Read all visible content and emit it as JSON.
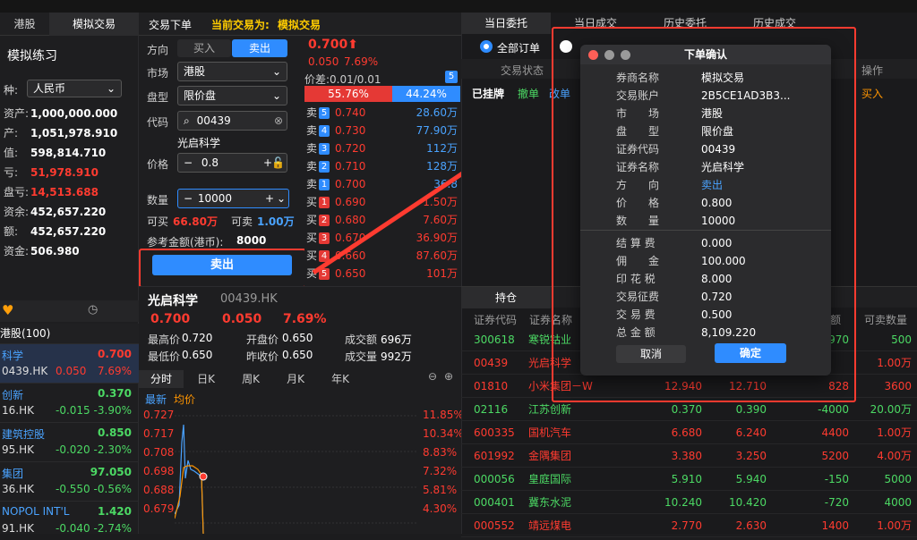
{
  "left": {
    "tabs": [
      "港股",
      "模拟交易"
    ],
    "title": "模拟练习",
    "currency_label": "种:",
    "currency_value": "人民币",
    "account_rows": [
      {
        "label": "资产:",
        "value": "1,000,000.000",
        "color": "#ffffff"
      },
      {
        "label": "产:",
        "value": "1,051,978.910",
        "color": "#ffffff"
      },
      {
        "label": "值:",
        "value": "598,814.710",
        "color": "#ffffff"
      },
      {
        "label": "亏:",
        "value": "51,978.910",
        "color": "#ff3b30"
      },
      {
        "label": "盘亏:",
        "value": "14,513.688",
        "color": "#ff3b30"
      },
      {
        "label": "资余:",
        "value": "452,657.220",
        "color": "#ffffff"
      },
      {
        "label": "额:",
        "value": "452,657.220",
        "color": "#ffffff"
      },
      {
        "label": "资金:",
        "value": "506.980",
        "color": "#ffffff"
      }
    ],
    "watch_header": "港股(100)",
    "watch_items": [
      {
        "name": "科学",
        "code": "0439.HK",
        "price": "0.700",
        "change": "0.050",
        "pct": "7.69%",
        "color": "#ff3b30"
      },
      {
        "name": "创新",
        "code": "16.HK",
        "price": "0.370",
        "change": "-0.015",
        "pct": "-3.90%",
        "color": "#4cd964"
      },
      {
        "name": "建筑控股",
        "code": "95.HK",
        "price": "0.850",
        "change": "-0.020",
        "pct": "-2.30%",
        "color": "#4cd964"
      },
      {
        "name": "集团",
        "code": "36.HK",
        "price": "97.050",
        "change": "-0.550",
        "pct": "-0.56%",
        "color": "#4cd964"
      },
      {
        "name": "NOPOL INT'L",
        "code": "91.HK",
        "price": "1.420",
        "change": "-0.040",
        "pct": "-2.74%",
        "color": "#4cd964"
      }
    ]
  },
  "form": {
    "tab": "交易下单",
    "current_label": "当前交易为:",
    "current_value": "模拟交易",
    "direction_label": "方向",
    "buy_label": "买入",
    "sell_label": "卖出",
    "market_label": "市场",
    "market_value": "港股",
    "ordertype_label": "盘型",
    "ordertype_value": "限价盘",
    "code_label": "代码",
    "code_value": "00439",
    "stock_name": "光启科学",
    "price_label": "价格",
    "price_value": "0.8",
    "qty_label": "数量",
    "qty_value": "10000",
    "can_buy_label": "可买",
    "can_buy_value": "66.80万",
    "can_sell_label": "可卖",
    "can_sell_value": "1.00万",
    "ref_amount_label": "参考金额(港币):",
    "ref_amount_value": "8000",
    "submit_label": "卖出"
  },
  "book": {
    "price": "0.700",
    "change": "0.050",
    "pct": "7.69%",
    "spread": "价差:0.01/0.01",
    "level_badge": "5",
    "bid_ratio": "55.76%",
    "ask_ratio": "44.24%",
    "asks": [
      {
        "side": "卖",
        "level": "5",
        "price": "0.740",
        "vol": "28.60万"
      },
      {
        "side": "卖",
        "level": "4",
        "price": "0.730",
        "vol": "77.90万"
      },
      {
        "side": "卖",
        "level": "3",
        "price": "0.720",
        "vol": "112万"
      },
      {
        "side": "卖",
        "level": "2",
        "price": "0.710",
        "vol": "128万"
      },
      {
        "side": "卖",
        "level": "1",
        "price": "0.700",
        "vol": "36.8"
      }
    ],
    "bids": [
      {
        "side": "买",
        "level": "1",
        "price": "0.690",
        "vol": "1.50万"
      },
      {
        "side": "买",
        "level": "2",
        "price": "0.680",
        "vol": "7.60万"
      },
      {
        "side": "买",
        "level": "3",
        "price": "0.670",
        "vol": "36.90万"
      },
      {
        "side": "买",
        "level": "4",
        "price": "0.660",
        "vol": "87.60万"
      },
      {
        "side": "买",
        "level": "5",
        "price": "0.650",
        "vol": "101万"
      }
    ]
  },
  "quote": {
    "name": "光启科学",
    "code": "00439.HK",
    "price": "0.700",
    "change": "0.050",
    "pct": "7.69%",
    "high_label": "最高价",
    "high": "0.720",
    "open_label": "开盘价",
    "open": "0.650",
    "amount_label": "成交额",
    "amount": "696万",
    "low_label": "最低价",
    "low": "0.650",
    "prev_label": "昨收价",
    "prev": "0.650",
    "volume_label": "成交量",
    "volume": "992万"
  },
  "chart": {
    "tabs": [
      "分时",
      "日K",
      "周K",
      "月K",
      "年K"
    ],
    "legend_latest": "最新",
    "legend_avg": "均价",
    "y_labels": [
      "0.727",
      "0.717",
      "0.708",
      "0.698",
      "0.688",
      "0.679"
    ],
    "pct_labels": [
      "11.85%",
      "10.34%",
      "8.83%",
      "7.32%",
      "5.81%",
      "4.30%"
    ]
  },
  "orders": {
    "tabs": [
      "当日委托",
      "当日成交",
      "历史委托",
      "历史成交"
    ],
    "filter_all": "全部订单",
    "status_header": "交易状态",
    "op_header": "操作",
    "row_status": "已挂牌",
    "row_cancel": "撤单",
    "row_modify": "改单",
    "row_side": "买入"
  },
  "positions": {
    "tab": "持仓",
    "headers": [
      "证券代码",
      "证券名称",
      "额",
      "可卖数量"
    ],
    "rows": [
      {
        "code": "300618",
        "name": "寒锐钴业",
        "c1": "",
        "c2": "",
        "c3": "970",
        "c4": "500",
        "color": "#4cd964"
      },
      {
        "code": "00439",
        "name": "光启科学",
        "c1": "",
        "c2": "",
        "c3": "",
        "c4": "1.00万",
        "color": "#ff3b30"
      },
      {
        "code": "01810",
        "name": "小米集团－W",
        "c1": "12.940",
        "c2": "12.710",
        "c3": "828",
        "c4": "3600",
        "color": "#ff3b30"
      },
      {
        "code": "02116",
        "name": "江苏创新",
        "c1": "0.370",
        "c2": "0.390",
        "c3": "-4000",
        "c4": "20.00万",
        "color": "#4cd964"
      },
      {
        "code": "600335",
        "name": "国机汽车",
        "c1": "6.680",
        "c2": "6.240",
        "c3": "4400",
        "c4": "1.00万",
        "color": "#ff3b30"
      },
      {
        "code": "601992",
        "name": "金隅集团",
        "c1": "3.380",
        "c2": "3.250",
        "c3": "5200",
        "c4": "4.00万",
        "color": "#ff3b30"
      },
      {
        "code": "000056",
        "name": "皇庭国际",
        "c1": "5.910",
        "c2": "5.940",
        "c3": "-150",
        "c4": "5000",
        "color": "#4cd964"
      },
      {
        "code": "000401",
        "name": "冀东水泥",
        "c1": "10.240",
        "c2": "10.420",
        "c3": "-720",
        "c4": "4000",
        "color": "#4cd964"
      },
      {
        "code": "000552",
        "name": "靖远煤电",
        "c1": "2.770",
        "c2": "2.630",
        "c3": "1400",
        "c4": "1.00万",
        "color": "#ff3b30"
      }
    ]
  },
  "dialog": {
    "title": "下单确认",
    "rows": [
      {
        "label": "券商名称",
        "value": "模拟交易",
        "color": "#ffffff"
      },
      {
        "label": "交易账户",
        "value": "2B5CE1AD3B3...",
        "color": "#ffffff"
      },
      {
        "label": "市　　场",
        "value": "港股",
        "color": "#ffffff"
      },
      {
        "label": "盘　　型",
        "value": "限价盘",
        "color": "#ffffff"
      },
      {
        "label": "证券代码",
        "value": "00439",
        "color": "#ffffff"
      },
      {
        "label": "证券名称",
        "value": "光启科学",
        "color": "#ffffff"
      },
      {
        "label": "方　　向",
        "value": "卖出",
        "color": "#4aa3ff"
      },
      {
        "label": "价　　格",
        "value": "0.800",
        "color": "#ffffff"
      },
      {
        "label": "数　　量",
        "value": "10000",
        "color": "#ffffff"
      }
    ],
    "fees": [
      {
        "label": "结 算 费",
        "value": "0.000"
      },
      {
        "label": "佣　　金",
        "value": "100.000"
      },
      {
        "label": "印 花 税",
        "value": "8.000"
      },
      {
        "label": "交易征费",
        "value": "0.720"
      },
      {
        "label": "交 易 费",
        "value": "0.500"
      },
      {
        "label": "总 金 额",
        "value": "8,109.220"
      }
    ],
    "cancel_label": "取消",
    "confirm_label": "确定"
  },
  "colors": {
    "up": "#ff3b30",
    "down": "#4cd964",
    "accent": "#2f8cff",
    "annotation": "#ff3b30"
  }
}
